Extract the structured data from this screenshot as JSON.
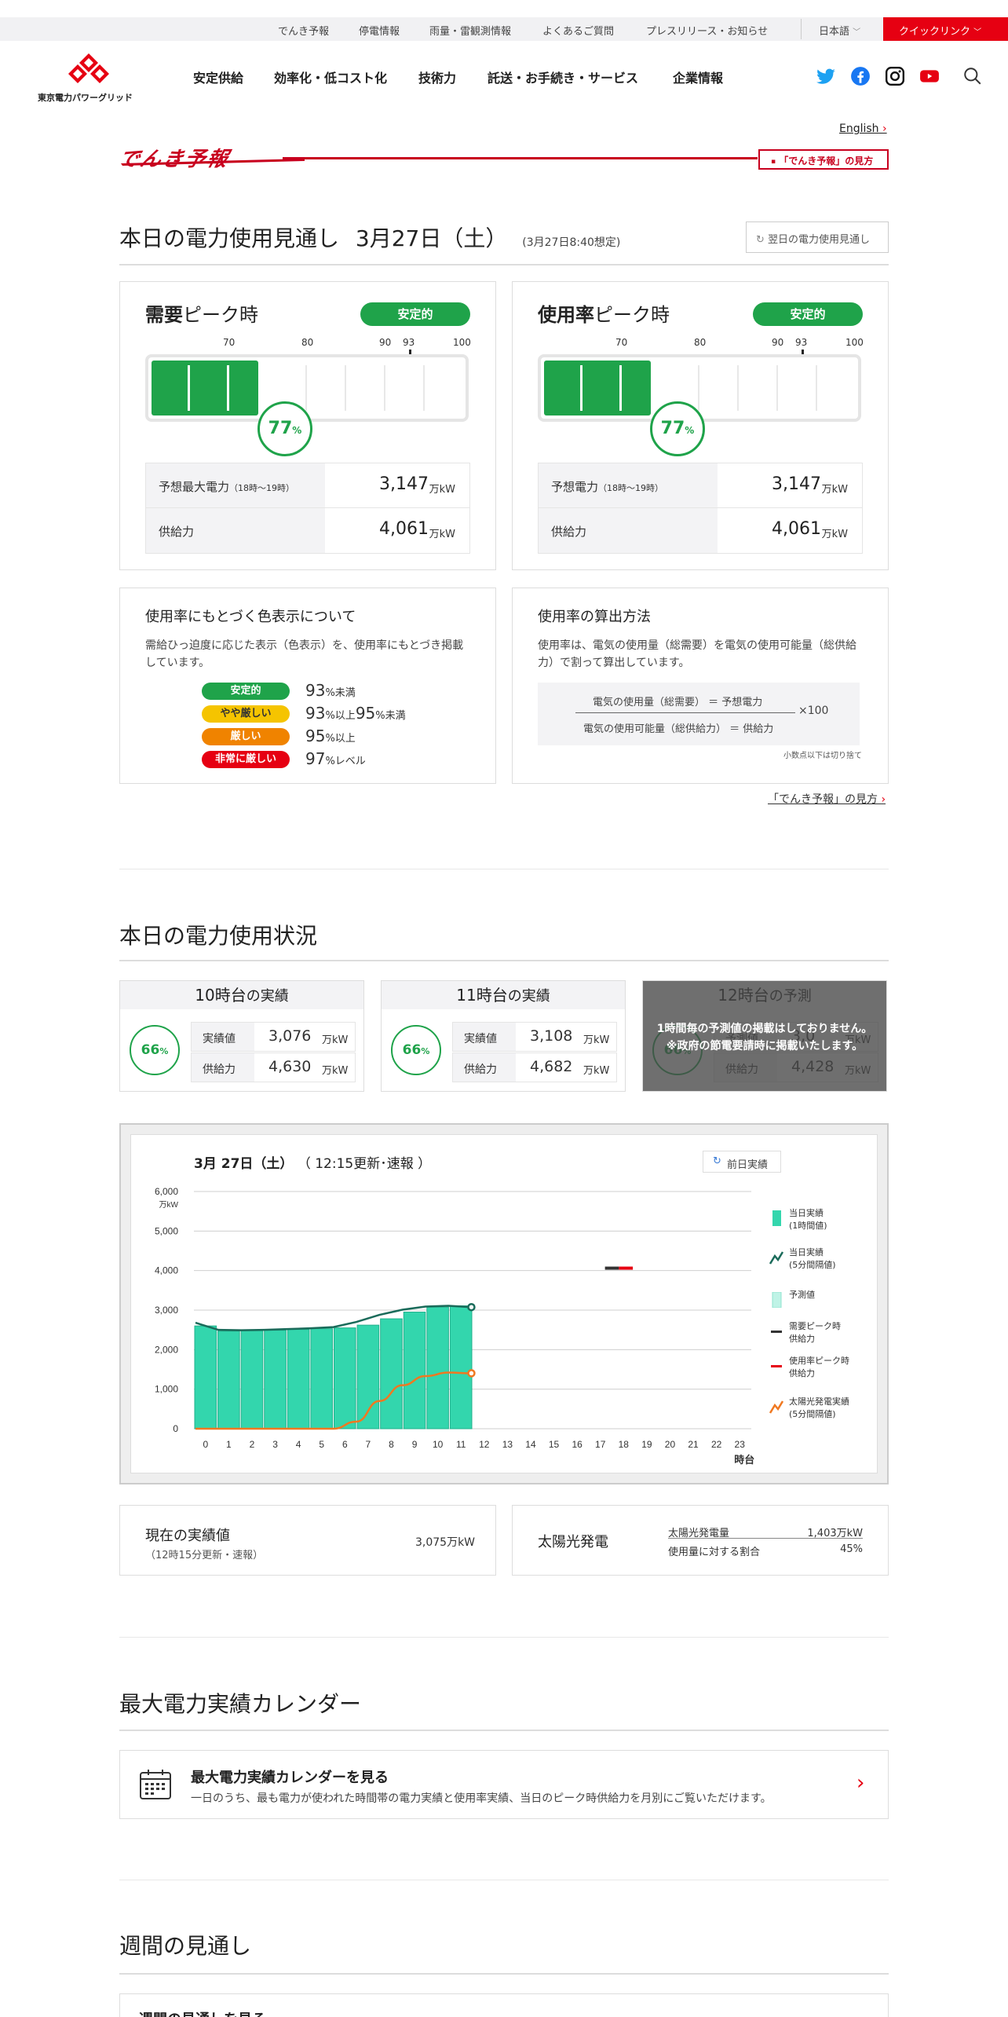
{
  "util_nav": [
    "でんき予報",
    "停電情報",
    "雨量・雷観測情報",
    "よくあるご質問",
    "プレスリリース・お知らせ"
  ],
  "language": "日本語",
  "quick_link": "クイックリンク",
  "logo_text": "東京電力パワーグリッド",
  "global_nav": [
    "安定供給",
    "効率化・低コスト化",
    "技術力",
    "託送・お手続き・サービス",
    "企業情報"
  ],
  "english_link": "English",
  "denki_logo": "でんき予報",
  "howto_badge": "「でんき予報」の見方",
  "today_forecast": {
    "title": "本日の電力使用見通し",
    "date": "3月27日（土）",
    "assumed": "(3月27日8:40想定)",
    "next_day_button": "翌日の電力使用見通し"
  },
  "demand_card": {
    "title_bold": "需要",
    "title_rest": "ピーク時",
    "status": "安定的",
    "gauge_ticks": [
      "70",
      "80",
      "90",
      "93",
      "100"
    ],
    "percent": 77,
    "percent_unit": "%",
    "rows": [
      {
        "label": "予想最大電力",
        "sub": "（18時～19時）",
        "value": "3,147",
        "unit": "万kW"
      },
      {
        "label": "供給力",
        "sub": "",
        "value": "4,061",
        "unit": "万kW"
      }
    ]
  },
  "usage_card": {
    "title_bold": "使用率",
    "title_rest": "ピーク時",
    "status": "安定的",
    "gauge_ticks": [
      "70",
      "80",
      "90",
      "93",
      "100"
    ],
    "percent": 77,
    "percent_unit": "%",
    "rows": [
      {
        "label": "予想電力",
        "sub": "（18時～19時）",
        "value": "3,147",
        "unit": "万kW"
      },
      {
        "label": "供給力",
        "sub": "",
        "value": "4,061",
        "unit": "万kW"
      }
    ]
  },
  "color_info": {
    "title": "使用率にもとづく色表示について",
    "text": "需給ひっ迫度に応じた表示（色表示）を、使用率にもとづき掲載しています。",
    "levels": [
      {
        "badge": "安定的",
        "color": "#1fa34a",
        "text_color": "#ffffff",
        "n1": "93",
        "u1": "%未満",
        "n2": "",
        "u2": ""
      },
      {
        "badge": "やや厳しい",
        "color": "#f5c400",
        "text_color": "#333333",
        "n1": "93",
        "u1": "%以上",
        "n2": "95",
        "u2": "%未満"
      },
      {
        "badge": "厳しい",
        "color": "#f08300",
        "text_color": "#ffffff",
        "n1": "95",
        "u1": "%以上",
        "n2": "",
        "u2": ""
      },
      {
        "badge": "非常に厳しい",
        "color": "#e60012",
        "text_color": "#ffffff",
        "n1": "97",
        "u1": "%レベル",
        "n2": "",
        "u2": ""
      }
    ]
  },
  "calc_info": {
    "title": "使用率の算出方法",
    "text": "使用率は、電気の使用量（総需要）を電気の使用可能量（総供給力）で割って算出しています。",
    "numerator": "電気の使用量（総需要） ＝ 予想電力",
    "denominator": "電気の使用可能量（総供給力） ＝ 供給力",
    "times": "×100",
    "note": "小数点以下は切り捨て"
  },
  "howto_link": "「でんき予報」の見方",
  "today_usage": {
    "title": "本日の電力使用状況",
    "hours": [
      {
        "hour": "10時台",
        "kind": "の実績",
        "percent": 66,
        "r1_label": "実績値",
        "r1_value": "3,076",
        "r2_label": "供給力",
        "r2_value": "4,630",
        "unit": "万kW"
      },
      {
        "hour": "11時台",
        "kind": "の実績",
        "percent": 66,
        "r1_label": "実績値",
        "r1_value": "3,108",
        "r2_label": "供給力",
        "r2_value": "4,682",
        "unit": "万kW"
      },
      {
        "hour": "12時台",
        "kind": "の予測",
        "percent": 66,
        "r1_label": "予測値",
        "r1_value": "3,0",
        "r2_label": "供給力",
        "r2_value": "4,428",
        "unit": "万kW"
      }
    ],
    "overlay_line1": "1時間毎の予測値の掲載はしておりません。",
    "overlay_line2": "※政府の節電要請時に掲載いたします。"
  },
  "chart_header": {
    "date": "3月 27日（土）",
    "update": "（ 12:15更新･速報 ）",
    "prev_button": "前日実績",
    "y_unit": "万kW",
    "x_unit": "時台"
  },
  "chart_data": {
    "type": "bar",
    "title": "",
    "xlabel": "時台",
    "ylabel": "万kW",
    "ylim": [
      0,
      6000
    ],
    "yticks": [
      "0",
      "1,000",
      "2,000",
      "3,000",
      "4,000",
      "5,000",
      "6,000"
    ],
    "categories": [
      "0",
      "1",
      "2",
      "3",
      "4",
      "5",
      "6",
      "7",
      "8",
      "9",
      "10",
      "11",
      "12",
      "13",
      "14",
      "15",
      "16",
      "17",
      "18",
      "19",
      "20",
      "21",
      "22",
      "23"
    ],
    "series": [
      {
        "name": "当日実績\n(1時間値)",
        "kind": "bar",
        "color": "#33d6ad",
        "values": [
          2600,
          2470,
          2480,
          2490,
          2510,
          2530,
          2550,
          2620,
          2780,
          2950,
          3076,
          3108
        ]
      },
      {
        "name": "当日実績\n(5分間隔値)",
        "kind": "line",
        "color": "#1a6b5a",
        "values": [
          2680,
          2500,
          2490,
          2500,
          2520,
          2540,
          2570,
          2700,
          2880,
          3010,
          3090,
          3110,
          3075
        ]
      },
      {
        "name": "太陽光発電実績\n(5分間隔値)",
        "kind": "line",
        "color": "#f07820",
        "values": [
          0,
          0,
          0,
          0,
          0,
          0,
          0,
          180,
          700,
          1100,
          1330,
          1420,
          1403
        ]
      }
    ],
    "peak_supply": {
      "hour": 18,
      "demand_value": 4061,
      "usage_value": 4061
    },
    "legend": [
      {
        "label": "当日実績\n(1時間値)",
        "icon": "bar",
        "color": "#33d6ad"
      },
      {
        "label": "当日実績\n(5分間隔値)",
        "icon": "line",
        "color": "#1a6b5a"
      },
      {
        "label": "予測値",
        "icon": "box",
        "color": "#bff3e6"
      },
      {
        "label": "需要ピーク時\n供給力",
        "icon": "dash",
        "color": "#333333"
      },
      {
        "label": "使用率ピーク時\n供給力",
        "icon": "dash",
        "color": "#e60012"
      },
      {
        "label": "太陽光発電実績\n(5分間隔値)",
        "icon": "line",
        "color": "#f07820"
      }
    ]
  },
  "current_actual": {
    "label": "現在の実績値",
    "sub": "（12時15分更新・速報）",
    "value": "3,075万kW"
  },
  "solar": {
    "label": "太陽光発電",
    "r1_label": "太陽光発電量",
    "r1_value": "1,403万kW",
    "r2_label": "使用量に対する割合",
    "r2_value": "45%"
  },
  "calendar": {
    "section_title": "最大電力実績カレンダー",
    "link_title": "最大電力実績カレンダーを見る",
    "link_desc": "一日のうち、最も電力が使われた時間帯の電力実績と使用率実績、当日のピーク時供給力を月別にご覧いただけます。"
  },
  "weekly": {
    "section_title": "週間の見通し",
    "link_title": "週間の見通しを見る"
  },
  "colors": {
    "brand_red": "#e60012",
    "stable_green": "#1fa34a"
  }
}
